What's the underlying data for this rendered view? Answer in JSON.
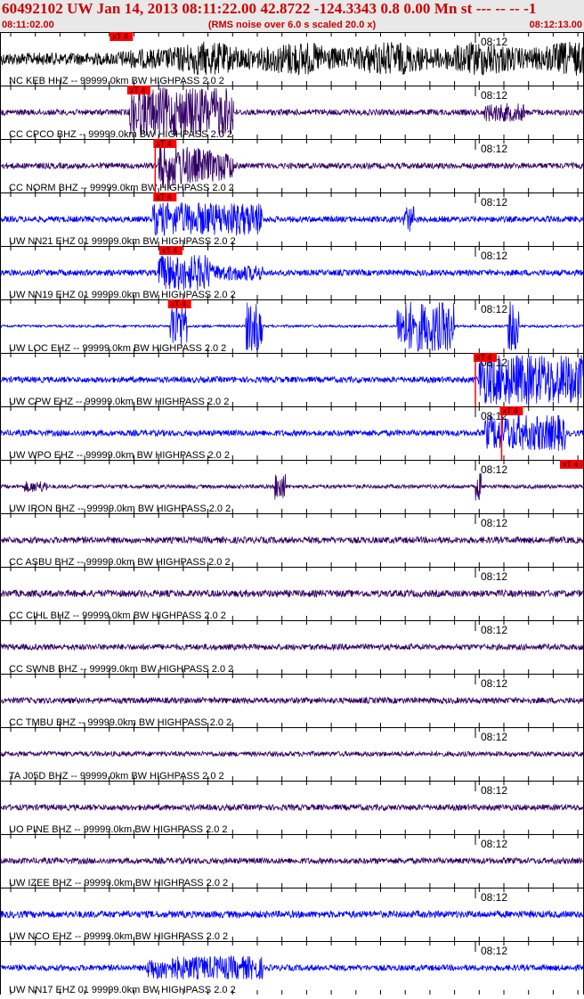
{
  "header": {
    "title": "60492102 UW Jan 14, 2013 08:11:22.00   42.8722 -124.3343  0.8 0.00 Mn st --- -- --  -1",
    "start_time": "08:11:02.00",
    "note": "(RMS noise over 6.0 s scaled 20.0 x)",
    "end_time": "08:12:13.00"
  },
  "minute_label": "08:12",
  "pick_label": "xT 4",
  "colors": {
    "title_red": "#cc0000",
    "pick_red": "#ff0000",
    "blue_trace": "#0000ff",
    "purple_trace": "#330066",
    "black_trace": "#000000"
  },
  "traces": [
    {
      "label": "NC KEB HHZ -- 99999.0km BW  HIGHPASS  2.0  2",
      "color": "#000000",
      "pick": 0.19,
      "pick_line": false
    },
    {
      "label": "CC CPCO BHZ -- 99999.0km BW  HIGHPASS  2.0  2",
      "color": "#330066",
      "pick": 0.22,
      "pick_line": false
    },
    {
      "label": "CC NORM BHZ -- 99999.0km BW  HIGHPASS  2.0  2",
      "color": "#330066",
      "pick": 0.265,
      "pick_line": true
    },
    {
      "label": "UW NN21 EHZ 01 99999.0km BW  HIGHPASS  2.0  2",
      "color": "#0000ff",
      "pick": 0.265,
      "pick_line": false
    },
    {
      "label": "UW NN19 EHZ 01 99999.0km BW  HIGHPASS  2.0  2",
      "color": "#0000ff",
      "pick": 0.275,
      "pick_line": false
    },
    {
      "label": "UW LOC EHZ -- 99999.0km BW  HIGHPASS  2.0  2",
      "color": "#0000ff",
      "pick": 0.29,
      "pick_line": false
    },
    {
      "label": "UW CPW EHZ -- 99999.0km BW  HIGHPASS  2.0  2",
      "color": "#0000ff",
      "pick": 0.815,
      "pick_line": true
    },
    {
      "label": "UW WPO EHZ -- 99999.0km BW  HIGHPASS  2.0  2",
      "color": "#0000ff",
      "pick": 0.86,
      "pick_line": true
    },
    {
      "label": "UW IRON BHZ -- 99999.0km BW  HIGHPASS  2.0  2",
      "color": "#330066",
      "pick": 0.985,
      "pick_line": false
    },
    {
      "label": "CC ASBU BHZ -- 99999.0km BW  HIGHPASS  2.0  2",
      "color": "#330066",
      "pick": null,
      "pick_line": false
    },
    {
      "label": "CC CIHL BHZ -- 99999.0km BW  HIGHPASS  2.0  2",
      "color": "#330066",
      "pick": null,
      "pick_line": false
    },
    {
      "label": "CC SWNB BHZ -- 99999.0km BW  HIGHPASS  2.0  2",
      "color": "#330066",
      "pick": null,
      "pick_line": false
    },
    {
      "label": "CC TMBU BHZ -- 99999.0km BW  HIGHPASS  2.0  2",
      "color": "#330066",
      "pick": null,
      "pick_line": false
    },
    {
      "label": "TA J05D BHZ -- 99999.0km BW  HIGHPASS  2.0  2",
      "color": "#330066",
      "pick": null,
      "pick_line": false
    },
    {
      "label": "UO PINE BHZ -- 99999.0km BW  HIGHPASS  2.0  2",
      "color": "#330066",
      "pick": null,
      "pick_line": false
    },
    {
      "label": "UW IZEE BHZ -- 99999.0km BW  HIGHPASS  2.0  2",
      "color": "#330066",
      "pick": null,
      "pick_line": false
    },
    {
      "label": "UW NCO EHZ -- 99999.0km BW  HIGHPASS  2.0  2",
      "color": "#0000ff",
      "pick": null,
      "pick_line": false
    },
    {
      "label": "UW NN17 EHZ 01 99999.0km BW  HIGHPASS  2.0  2",
      "color": "#0000ff",
      "pick": null,
      "pick_line": false
    }
  ]
}
